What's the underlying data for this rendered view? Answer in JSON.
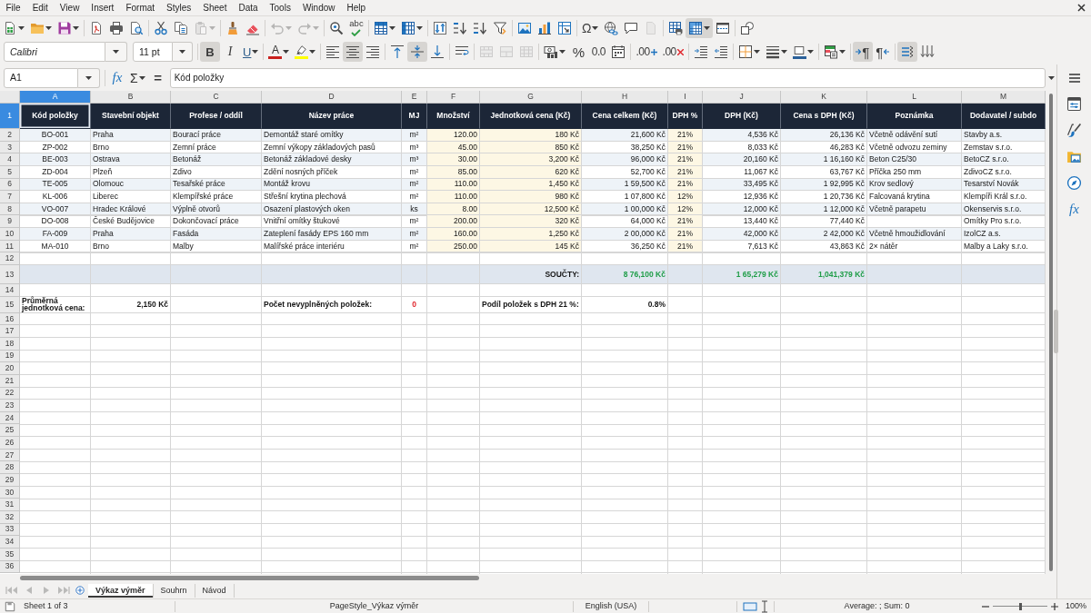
{
  "menu_bar": {
    "items": [
      "File",
      "Edit",
      "View",
      "Insert",
      "Format",
      "Styles",
      "Sheet",
      "Data",
      "Tools",
      "Window",
      "Help"
    ]
  },
  "standard_toolbar": {
    "groups": [
      {
        "buttons": [
          {
            "kind": "new",
            "on": false,
            "disabled": false
          },
          {
            "kind": "open",
            "on": false,
            "disabled": false
          },
          {
            "kind": "save",
            "on": false,
            "disabled": false
          }
        ]
      },
      {
        "buttons": [
          {
            "kind": "export_pdf",
            "on": false,
            "disabled": false
          },
          {
            "kind": "print",
            "on": false,
            "disabled": false
          },
          {
            "kind": "print_preview",
            "on": false,
            "disabled": false
          }
        ]
      },
      {
        "buttons": [
          {
            "kind": "cut",
            "on": false,
            "disabled": false
          },
          {
            "kind": "copy",
            "on": false,
            "disabled": false
          },
          {
            "kind": "paste",
            "on": false,
            "disabled": true
          }
        ]
      },
      {
        "buttons": [
          {
            "kind": "clone_formatting",
            "on": false,
            "disabled": false
          },
          {
            "kind": "clear_formatting",
            "on": false,
            "disabled": false
          }
        ]
      },
      {
        "buttons": [
          {
            "kind": "undo",
            "on": false,
            "disabled": true
          },
          {
            "kind": "redo",
            "on": false,
            "disabled": true
          }
        ]
      },
      {
        "buttons": [
          {
            "kind": "find_replace",
            "on": false,
            "disabled": false
          },
          {
            "kind": "spelling",
            "glyph": "abc",
            "on": false,
            "disabled": false
          }
        ]
      },
      {
        "buttons": [
          {
            "kind": "rows",
            "on": false,
            "disabled": false
          },
          {
            "kind": "columns",
            "on": false,
            "disabled": false
          }
        ]
      },
      {
        "buttons": [
          {
            "kind": "sort",
            "on": false,
            "disabled": false
          },
          {
            "kind": "sort_ascending",
            "on": false,
            "disabled": false
          },
          {
            "kind": "sort_descending",
            "on": false,
            "disabled": false
          },
          {
            "kind": "autofilter",
            "on": false,
            "disabled": false
          }
        ]
      },
      {
        "buttons": [
          {
            "kind": "image",
            "on": false,
            "disabled": false
          },
          {
            "kind": "chart",
            "on": false,
            "disabled": false
          },
          {
            "kind": "pivot_table",
            "on": false,
            "disabled": false
          }
        ]
      },
      {
        "buttons": [
          {
            "kind": "special_character",
            "glyph": "Ω",
            "on": false,
            "disabled": false
          },
          {
            "kind": "hyperlink",
            "on": false,
            "disabled": false
          },
          {
            "kind": "comment",
            "on": false,
            "disabled": false
          },
          {
            "kind": "header_footer",
            "on": false,
            "disabled": true
          }
        ]
      },
      {
        "buttons": [
          {
            "kind": "print_area",
            "on": false,
            "disabled": false
          },
          {
            "kind": "freeze",
            "on": true,
            "disabled": false
          },
          {
            "kind": "split_window",
            "on": false,
            "disabled": false
          }
        ]
      },
      {
        "buttons": [
          {
            "kind": "draw_functions",
            "on": false,
            "disabled": false
          }
        ]
      }
    ]
  },
  "formatting_toolbar": {
    "font_name": "Calibri",
    "font_size": "11 pt",
    "groups": [
      {
        "buttons": [
          {
            "kind": "bold",
            "glyph": "B",
            "on": true,
            "disabled": false
          },
          {
            "kind": "italic",
            "glyph": "I",
            "on": false,
            "disabled": false
          },
          {
            "kind": "underline",
            "glyph": "U",
            "on": false,
            "disabled": false
          }
        ]
      },
      {
        "buttons": [
          {
            "kind": "font_color",
            "glyph": "A",
            "color": "#c9211e",
            "on": false,
            "disabled": false
          },
          {
            "kind": "highlight",
            "color": "#ffff00",
            "on": false,
            "disabled": false
          }
        ]
      },
      {
        "buttons": [
          {
            "kind": "align_left",
            "on": false,
            "disabled": false
          },
          {
            "kind": "align_center",
            "on": true,
            "disabled": false
          },
          {
            "kind": "align_right",
            "on": false,
            "disabled": false
          }
        ]
      },
      {
        "buttons": [
          {
            "kind": "align_top",
            "on": false,
            "disabled": false
          },
          {
            "kind": "align_middle",
            "on": true,
            "disabled": false
          },
          {
            "kind": "align_bottom",
            "on": false,
            "disabled": false
          }
        ]
      },
      {
        "buttons": [
          {
            "kind": "wrap_text",
            "on": false,
            "disabled": false
          }
        ]
      },
      {
        "buttons": [
          {
            "kind": "merge_center",
            "on": false,
            "disabled": true
          },
          {
            "kind": "merge",
            "on": false,
            "disabled": true
          },
          {
            "kind": "unmerge",
            "on": false,
            "disabled": true
          }
        ]
      },
      {
        "buttons": [
          {
            "kind": "currency",
            "on": false,
            "disabled": false
          },
          {
            "kind": "percent",
            "glyph": "%",
            "on": false,
            "disabled": false
          },
          {
            "kind": "number",
            "glyph": "0.0",
            "on": false,
            "disabled": false
          },
          {
            "kind": "date",
            "on": false,
            "disabled": false
          }
        ]
      },
      {
        "buttons": [
          {
            "kind": "add_decimal",
            "glyph": ".00",
            "on": false,
            "disabled": false
          },
          {
            "kind": "delete_decimal",
            "glyph": ".00",
            "on": false,
            "disabled": false
          }
        ]
      },
      {
        "buttons": [
          {
            "kind": "indent_increase",
            "on": false,
            "disabled": false
          },
          {
            "kind": "indent_decrease",
            "on": false,
            "disabled": false
          }
        ]
      },
      {
        "buttons": [
          {
            "kind": "borders",
            "on": false,
            "disabled": false
          },
          {
            "kind": "border_style",
            "on": false,
            "disabled": false
          },
          {
            "kind": "border_color",
            "color": "#2a6099",
            "on": false,
            "disabled": false
          }
        ]
      },
      {
        "buttons": [
          {
            "kind": "conditional",
            "on": false,
            "disabled": false
          }
        ]
      },
      {
        "buttons": [
          {
            "kind": "left_to_right",
            "glyph": "¶",
            "on": true,
            "disabled": false
          },
          {
            "kind": "right_to_left",
            "glyph": "¶",
            "on": false,
            "disabled": false
          }
        ]
      },
      {
        "buttons": [
          {
            "kind": "text_horizontal",
            "on": true,
            "disabled": false
          },
          {
            "kind": "text_vertical",
            "on": false,
            "disabled": false
          }
        ]
      }
    ]
  },
  "formula_bar": {
    "cell_reference": "A1",
    "function_wizard": "fx",
    "sum": "Σ",
    "formula": "=",
    "content": "Kód položky"
  },
  "sidebar": {
    "buttons": [
      {
        "kind": "properties"
      },
      {
        "kind": "styles"
      },
      {
        "kind": "gallery"
      },
      {
        "kind": "navigator"
      },
      {
        "kind": "functions",
        "glyph": "fx"
      }
    ]
  },
  "sheet": {
    "columns": [
      {
        "letter": "A",
        "kind": "code",
        "input": false,
        "selected": true
      },
      {
        "letter": "B",
        "kind": "text",
        "input": false,
        "selected": false
      },
      {
        "letter": "C",
        "kind": "text",
        "input": false,
        "selected": false
      },
      {
        "letter": "D",
        "kind": "text",
        "input": false,
        "selected": false
      },
      {
        "letter": "E",
        "kind": "unit",
        "input": false,
        "selected": false
      },
      {
        "letter": "F",
        "kind": "number",
        "input": true,
        "selected": false
      },
      {
        "letter": "G",
        "kind": "money",
        "input": true,
        "selected": false
      },
      {
        "letter": "H",
        "kind": "money",
        "input": false,
        "selected": false
      },
      {
        "letter": "I",
        "kind": "percent",
        "input": true,
        "selected": false
      },
      {
        "letter": "J",
        "kind": "money",
        "input": false,
        "selected": false
      },
      {
        "letter": "K",
        "kind": "money",
        "input": false,
        "selected": false
      },
      {
        "letter": "L",
        "kind": "text",
        "input": false,
        "selected": false
      },
      {
        "letter": "M",
        "kind": "text",
        "input": false,
        "selected": false
      }
    ],
    "rows": [
      {
        "number": "1",
        "kind": "header",
        "selected": true,
        "cells": [
          "Kód položky",
          "Stavební objekt",
          "Profese / oddíl",
          "Název práce",
          "MJ",
          "Množství",
          "Jednotková cena (Kč)",
          "Cena celkem (Kč)",
          "DPH %",
          "DPH (Kč)",
          "Cena s DPH (Kč)",
          "Poznámka",
          "Dodavatel / subdo"
        ]
      },
      {
        "number": "2",
        "kind": "data",
        "selected": false,
        "shaded": true,
        "cells": [
          "BO-001",
          "Praha",
          "Bourací práce",
          "Demontáž staré omítky",
          "m²",
          "120.00",
          "180 Kč",
          "21,600 Kč",
          "21%",
          "4,536 Kč",
          "26,136 Kč",
          "Včetně odávění sutí",
          "Stavby a.s."
        ]
      },
      {
        "number": "3",
        "kind": "data",
        "selected": false,
        "shaded": false,
        "cells": [
          "ZP-002",
          "Brno",
          "Zemní práce",
          "Zemní výkopy základových pasů",
          "m³",
          "45.00",
          "850 Kč",
          "38,250 Kč",
          "21%",
          "8,033 Kč",
          "46,283 Kč",
          "Včetně odvozu zeminy",
          "Zemstav s.r.o."
        ]
      },
      {
        "number": "4",
        "kind": "data",
        "selected": false,
        "shaded": true,
        "cells": [
          "BE-003",
          "Ostrava",
          "Betonáž",
          "Betonáž základové desky",
          "m³",
          "30.00",
          "3,200 Kč",
          "96,000 Kč",
          "21%",
          "20,160 Kč",
          "1 16,160 Kč",
          "Beton C25/30",
          "BetoCZ s.r.o."
        ]
      },
      {
        "number": "5",
        "kind": "data",
        "selected": false,
        "shaded": false,
        "cells": [
          "ZD-004",
          "Plzeň",
          "Zdivo",
          "Zdění nosných příček",
          "m²",
          "85.00",
          "620 Kč",
          "52,700 Kč",
          "21%",
          "11,067 Kč",
          "63,767 Kč",
          "Příčka 250 mm",
          "ZdivoCZ s.r.o."
        ]
      },
      {
        "number": "6",
        "kind": "data",
        "selected": false,
        "shaded": true,
        "cells": [
          "TE-005",
          "Olomouc",
          "Tesařské práce",
          "Montáž krovu",
          "m²",
          "110.00",
          "1,450 Kč",
          "1 59,500 Kč",
          "21%",
          "33,495 Kč",
          "1 92,995 Kč",
          "Krov sedlový",
          "Tesarství Novák"
        ]
      },
      {
        "number": "7",
        "kind": "data",
        "selected": false,
        "shaded": false,
        "cells": [
          "KL-006",
          "Liberec",
          "Klempířské práce",
          "Střešní krytina plechová",
          "m²",
          "110.00",
          "980 Kč",
          "1 07,800 Kč",
          "12%",
          "12,936 Kč",
          "1 20,736 Kč",
          "Falcovaná krytina",
          "Klempíři Král s.r.o."
        ]
      },
      {
        "number": "8",
        "kind": "data",
        "selected": false,
        "shaded": true,
        "cells": [
          "VO-007",
          "Hradec Králové",
          "Výplně otvorů",
          "Osazení plastových oken",
          "ks",
          "8.00",
          "12,500 Kč",
          "1 00,000 Kč",
          "12%",
          "12,000 Kč",
          "1 12,000 Kč",
          "Včetně parapetu",
          "Okenservis s.r.o."
        ]
      },
      {
        "number": "9",
        "kind": "data",
        "selected": false,
        "shaded": false,
        "cells": [
          "DO-008",
          "České Budějovice",
          "Dokončovací práce",
          "Vnitřní omítky štukové",
          "m²",
          "200.00",
          "320 Kč",
          "64,000 Kč",
          "21%",
          "13,440 Kč",
          "77,440 Kč",
          null,
          "Omítky Pro s.r.o."
        ]
      },
      {
        "number": "10",
        "kind": "data",
        "selected": false,
        "shaded": true,
        "cells": [
          "FA-009",
          "Praha",
          "Fasáda",
          "Zateplení fasády EPS 160 mm",
          "m²",
          "160.00",
          "1,250 Kč",
          "2 00,000 Kč",
          "21%",
          "42,000 Kč",
          "2 42,000 Kč",
          "Včetně hmoužidlování",
          "IzolCZ a.s."
        ]
      },
      {
        "number": "11",
        "kind": "data",
        "selected": false,
        "shaded": false,
        "cells": [
          "MA-010",
          "Brno",
          "Malby",
          "Malířské práce interiéru",
          "m²",
          "250.00",
          "145 Kč",
          "36,250 Kč",
          "21%",
          "7,613 Kč",
          "43,863 Kč",
          "2× nátěr",
          "Malby a Laky s.r.o."
        ]
      },
      {
        "number": "12",
        "kind": "empty",
        "selected": false
      },
      {
        "number": "13",
        "kind": "totals",
        "selected": false,
        "shaded": true,
        "cells": [
          null,
          null,
          null,
          null,
          null,
          null,
          {
            "text": "SOUČTY:",
            "kind": "caption"
          },
          {
            "text": "8 76,100 Kč",
            "kind": "total"
          },
          null,
          {
            "text": "1 65,279 Kč",
            "kind": "total"
          },
          {
            "text": "1,041,379 Kč",
            "kind": "total"
          },
          null,
          null
        ]
      },
      {
        "number": "14",
        "kind": "empty",
        "selected": false
      },
      {
        "number": "15",
        "kind": "stats",
        "selected": false,
        "shaded": false,
        "cells": [
          {
            "text": "Průměrná jednotková cena:",
            "kind": "label"
          },
          {
            "text": "2,150 Kč",
            "kind": "value"
          },
          null,
          {
            "text": "Počet nevyplněných položek:",
            "kind": "label"
          },
          {
            "text": "0",
            "kind": "count"
          },
          null,
          {
            "text": "Podíl položek s DPH 21 %:",
            "kind": "label"
          },
          {
            "text": "0.8%",
            "kind": "value"
          },
          null,
          null,
          null,
          null,
          null
        ]
      },
      {
        "number": "16",
        "kind": "empty",
        "selected": false
      },
      {
        "number": "17",
        "kind": "empty",
        "selected": false
      },
      {
        "number": "18",
        "kind": "empty",
        "selected": false
      },
      {
        "number": "19",
        "kind": "empty",
        "selected": false
      },
      {
        "number": "20",
        "kind": "empty",
        "selected": false
      },
      {
        "number": "21",
        "kind": "empty",
        "selected": false
      },
      {
        "number": "22",
        "kind": "empty",
        "selected": false
      },
      {
        "number": "23",
        "kind": "empty",
        "selected": false
      },
      {
        "number": "24",
        "kind": "empty",
        "selected": false
      },
      {
        "number": "25",
        "kind": "empty",
        "selected": false
      },
      {
        "number": "26",
        "kind": "empty",
        "selected": false
      },
      {
        "number": "27",
        "kind": "empty",
        "selected": false
      },
      {
        "number": "28",
        "kind": "empty",
        "selected": false
      },
      {
        "number": "29",
        "kind": "empty",
        "selected": false
      },
      {
        "number": "30",
        "kind": "empty",
        "selected": false
      },
      {
        "number": "31",
        "kind": "empty",
        "selected": false
      },
      {
        "number": "32",
        "kind": "empty",
        "selected": false
      },
      {
        "number": "33",
        "kind": "empty",
        "selected": false
      },
      {
        "number": "34",
        "kind": "empty",
        "selected": false
      },
      {
        "number": "35",
        "kind": "empty",
        "selected": false
      },
      {
        "number": "36",
        "kind": "empty",
        "selected": false
      }
    ]
  },
  "sheet_tabs": {
    "navigation_disabled": true,
    "tabs": [
      {
        "label": "Výkaz výměr",
        "selected": true
      },
      {
        "label": "Souhrn",
        "selected": false
      },
      {
        "label": "Návod",
        "selected": false
      }
    ]
  },
  "status_bar": {
    "sheet_position": "Sheet 1 of 3",
    "page_style": "PageStyle_Výkaz výměr",
    "language": "English (USA)",
    "selection_summary": "Average: ; Sum: 0",
    "zoom": {
      "level": 0.5,
      "reading": "100%"
    }
  }
}
